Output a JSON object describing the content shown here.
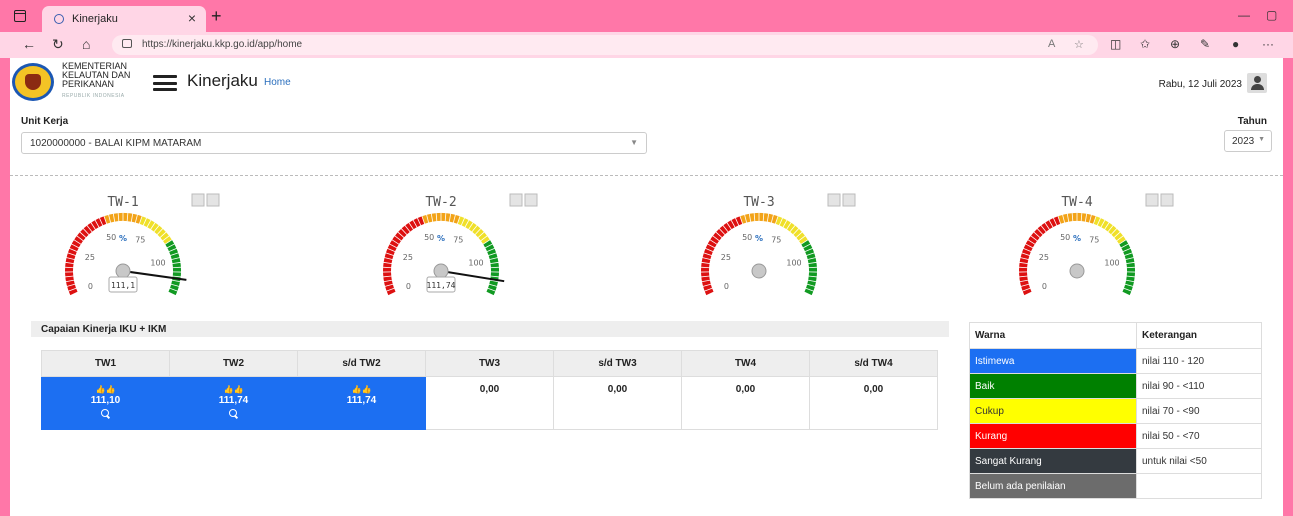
{
  "browser": {
    "tab_title": "Kinerjaku",
    "url": "https://kinerjaku.kkp.go.id/app/home"
  },
  "header": {
    "org_line1": "KEMENTERIAN",
    "org_line2": "KELAUTAN DAN",
    "org_line3": "PERIKANAN",
    "org_sub": "REPUBLIK INDONESIA",
    "brand": "Kinerjaku",
    "home_link": "Home",
    "date": "Rabu, 12 Juli 2023"
  },
  "filters": {
    "unit_kerja_label": "Unit Kerja",
    "unit_kerja_value": "1020000000 - BALAI KIPM MATARAM",
    "tahun_label": "Tahun",
    "tahun_value": "2023"
  },
  "gauges": [
    {
      "title": "TW-1",
      "value": 111.1,
      "readout": "111,1",
      "has_value": true
    },
    {
      "title": "TW-2",
      "value": 111.74,
      "readout": "111,74",
      "has_value": true
    },
    {
      "title": "TW-3",
      "value": null,
      "readout": "",
      "has_value": false
    },
    {
      "title": "TW-4",
      "value": null,
      "readout": "",
      "has_value": false
    }
  ],
  "gauge_scale": {
    "ticks": [
      "0",
      "25",
      "50",
      "75",
      "100"
    ],
    "unit": "%",
    "min": 0,
    "max": 120
  },
  "iku": {
    "title": "Capaian Kinerja IKU + IKM",
    "headers": [
      "TW1",
      "TW2",
      "s/d TW2",
      "TW3",
      "s/d TW3",
      "TW4",
      "s/d TW4"
    ],
    "cells": [
      {
        "value": "111,10",
        "highlight": true,
        "thumbs": true,
        "search": true
      },
      {
        "value": "111,74",
        "highlight": true,
        "thumbs": true,
        "search": true
      },
      {
        "value": "111,74",
        "highlight": true,
        "thumbs": true,
        "search": false
      },
      {
        "value": "0,00",
        "highlight": false,
        "thumbs": false,
        "search": false
      },
      {
        "value": "0,00",
        "highlight": false,
        "thumbs": false,
        "search": false
      },
      {
        "value": "0,00",
        "highlight": false,
        "thumbs": false,
        "search": false
      },
      {
        "value": "0,00",
        "highlight": false,
        "thumbs": false,
        "search": false
      }
    ],
    "highlight_color": "#1c6ff2"
  },
  "legend": {
    "headers": [
      "Warna",
      "Keterangan"
    ],
    "rows": [
      {
        "warna": "Istimewa",
        "keterangan": "nilai 110 - 120",
        "color": "#1c6ff2",
        "text_color": "#ffffff"
      },
      {
        "warna": "Baik",
        "keterangan": "nilai 90 - <110",
        "color": "#008000",
        "text_color": "#ffffff"
      },
      {
        "warna": "Cukup",
        "keterangan": "nilai 70 - <90",
        "color": "#ffff00",
        "text_color": "#333333"
      },
      {
        "warna": "Kurang",
        "keterangan": "nilai 50 - <70",
        "color": "#ff0000",
        "text_color": "#ffffff"
      },
      {
        "warna": "Sangat Kurang",
        "keterangan": "untuk nilai <50",
        "color": "#343a40",
        "text_color": "#ffffff"
      },
      {
        "warna": "Belum ada penilaian",
        "keterangan": "",
        "color": "#6c6c6c",
        "text_color": "#ffffff"
      }
    ]
  }
}
